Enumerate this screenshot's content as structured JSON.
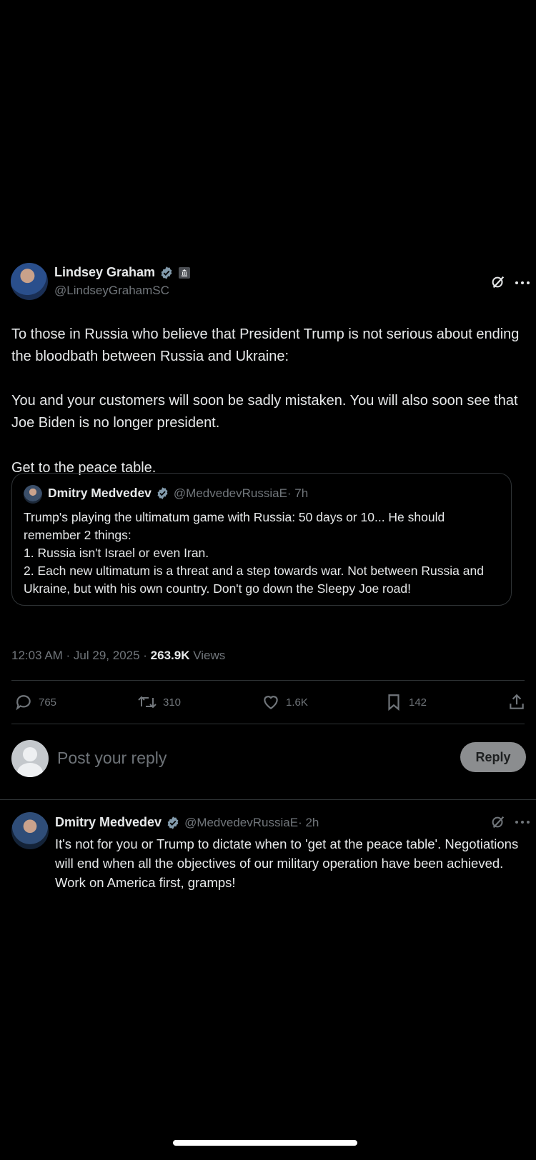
{
  "main_post": {
    "author_name": "Lindsey Graham",
    "author_handle": "@LindseyGrahamSC",
    "paragraphs": [
      "To those in Russia who believe that President Trump is not serious about ending the bloodbath between Russia and Ukraine:",
      "You and your customers will soon be sadly mistaken. You will also soon see that Joe Biden is no longer president.",
      "Get to the peace table."
    ],
    "timestamp": "12:03 AM · Jul 29, 2025 · ",
    "views_count": "263.9K",
    "views_label": " Views"
  },
  "quoted_post": {
    "author_name": "Dmitry Medvedev",
    "author_handle": "@MedvedevRussiaE",
    "time": " · 7h",
    "lines": [
      "Trump's playing the ultimatum game with Russia: 50 days or 10... He should remember 2 things:",
      "1. Russia isn't Israel or even Iran.",
      "2. Each new ultimatum is a threat and a step towards war. Not between Russia and Ukraine, but with his own country. Don't go down the Sleepy Joe road!"
    ]
  },
  "actions": {
    "replies": "765",
    "reposts": "310",
    "likes": "1.6K",
    "bookmarks": "142"
  },
  "reply_composer": {
    "placeholder": "Post your reply",
    "button_label": "Reply"
  },
  "reply_post": {
    "author_name": "Dmitry Medvedev",
    "author_handle": "@MedvedevRussiaE",
    "time": " · 2h",
    "text": "It's not for you or Trump to dictate when to 'get at the peace table'. Negotiations will end when all the objectives of our military operation have been achieved. Work on America first, gramps!"
  },
  "colors": {
    "background": "#000000",
    "text": "#e7e9ea",
    "muted": "#71767b",
    "verified_badge": "#829aab",
    "divider": "#2f3336"
  },
  "icons": [
    "grok-icon",
    "more-icon",
    "verified-badge-icon",
    "government-label-icon",
    "reply-icon",
    "repost-icon",
    "like-icon",
    "bookmark-icon",
    "share-icon"
  ]
}
